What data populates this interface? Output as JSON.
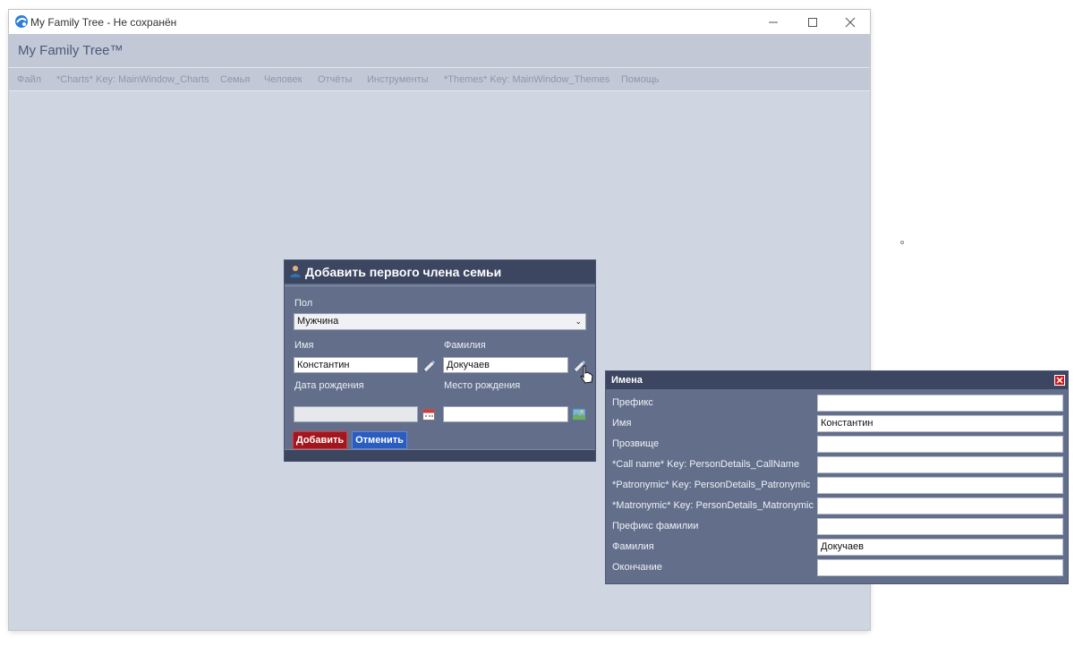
{
  "window": {
    "title": "My Family Tree - Не сохранён"
  },
  "header": {
    "app_name": "My Family Tree™"
  },
  "menu": {
    "items": [
      "Файл",
      "*Charts* Key: MainWindow_Charts",
      "Семья",
      "Человек",
      "Отчёты",
      "Инструменты",
      "*Themes* Key: MainWindow_Themes",
      "Помощь"
    ]
  },
  "dialog": {
    "title": "Добавить первого члена семьи",
    "gender_label": "Пол",
    "gender_value": "Мужчина",
    "first_name_label": "Имя",
    "first_name_value": "Константин",
    "last_name_label": "Фамилия",
    "last_name_value": "Докучаев",
    "birth_date_label": "Дата рождения",
    "birth_date_value": "",
    "birth_place_label": "Место рождения",
    "birth_place_value": "",
    "add_button": "Добавить",
    "cancel_button": "Отменить"
  },
  "names_panel": {
    "title": "Имена",
    "fields": [
      {
        "label": "Префикс",
        "value": ""
      },
      {
        "label": "Имя",
        "value": "Константин"
      },
      {
        "label": "Прозвище",
        "value": ""
      },
      {
        "label": "*Call name* Key: PersonDetails_CallName",
        "value": ""
      },
      {
        "label": "*Patronymic* Key: PersonDetails_Patronymic",
        "value": ""
      },
      {
        "label": "*Matronymic* Key: PersonDetails_Matronymic",
        "value": ""
      },
      {
        "label": "Префикс фамилии",
        "value": ""
      },
      {
        "label": "Фамилия",
        "value": "Докучаев"
      },
      {
        "label": "Окончание",
        "value": ""
      }
    ]
  },
  "colors": {
    "window_bg": "#cfd6e1",
    "header_bg": "#c2c8d6",
    "dialog_bg": "#636f8a",
    "dialog_header_bg": "#3c4660",
    "add_button_bg": "#a3161d",
    "cancel_button_bg": "#2a5dbf",
    "close_red": "#c8161d"
  },
  "icons": {
    "app_logo": "family-tree-logo-icon",
    "dialog_icon": "person-add-icon",
    "edit_name_icon": "pencil-icon",
    "calendar_icon": "calendar-icon",
    "place_icon": "map-icon",
    "cursor": "hand-pointer-icon"
  }
}
